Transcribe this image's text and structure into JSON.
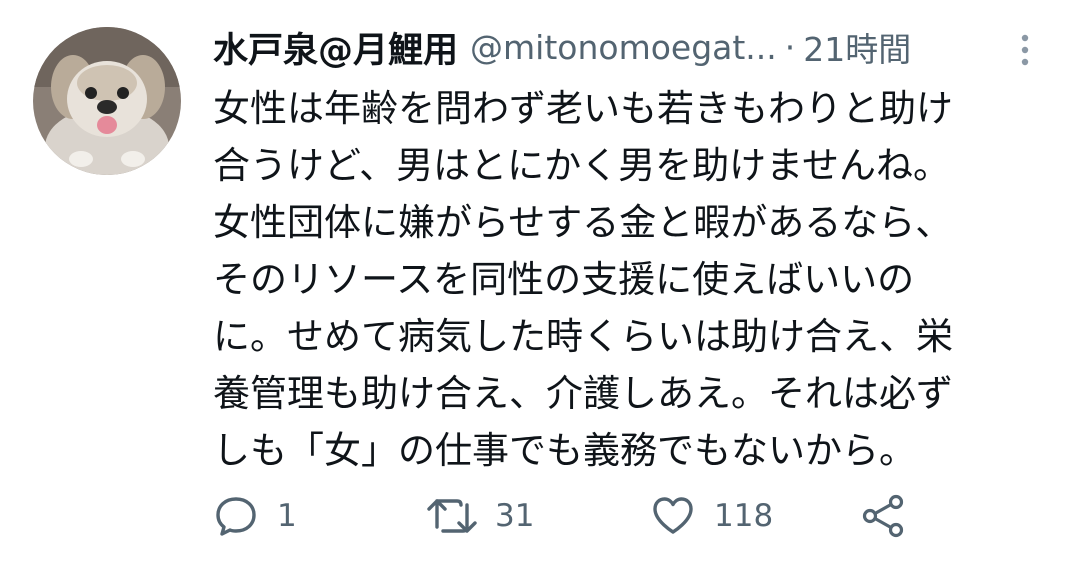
{
  "tweet": {
    "display_name": "水戸泉@月鯉用",
    "handle": "@mitonomoegat...",
    "separator": "·",
    "time": "21時間",
    "text": "女性は年齢を問わず老いも若きもわりと助け\n合うけど、男はとにかく男を助けませんね。\n女性団体に嫌がらせする金と暇があるなら、\nそのリソースを同性の支援に使えばいいの\nに。せめて病気した時くらいは助け合え、栄\n養管理も助け合え、介護しあえ。それは必ず\nしも「女」の仕事でも義務でもないから。"
  },
  "actions": {
    "reply_count": "1",
    "retweet_count": "31",
    "like_count": "118"
  },
  "icons": {
    "reply": "reply-icon",
    "retweet": "retweet-icon",
    "like": "heart-icon",
    "share": "share-icon",
    "more": "more-vertical-icon"
  },
  "colors": {
    "text": "#0f1419",
    "secondary": "#536471"
  }
}
